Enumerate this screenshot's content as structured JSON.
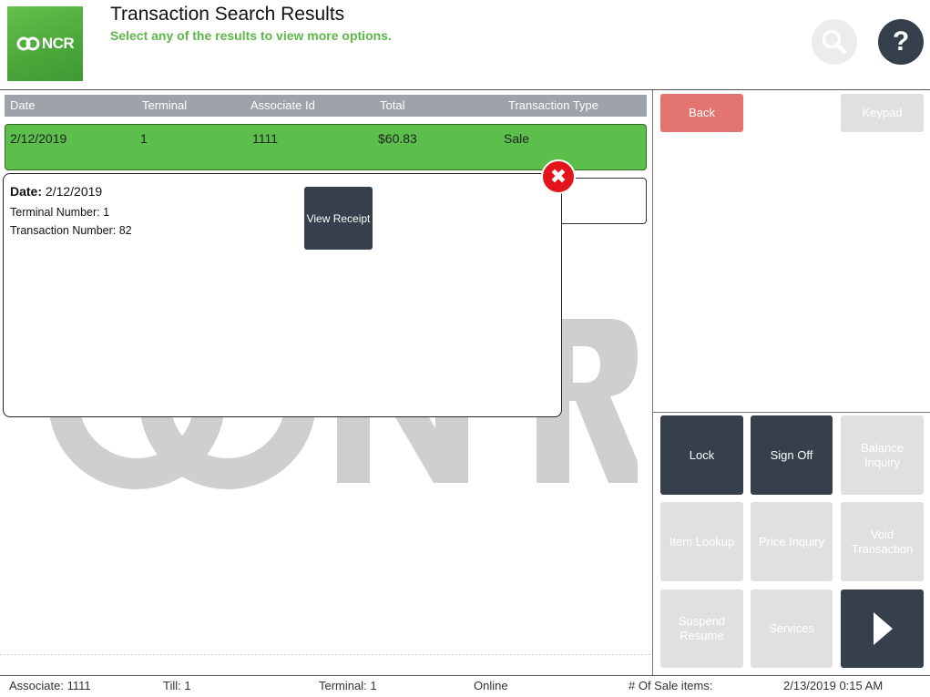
{
  "header": {
    "logo_text": "NCR",
    "title": "Transaction Search Results",
    "subtitle": "Select any of the results to view more options.",
    "help_label": "?"
  },
  "table": {
    "columns": [
      "Date",
      "Terminal",
      "Associate Id",
      "Total",
      "Transaction Type"
    ],
    "rows": [
      {
        "date": "2/12/2019",
        "terminal": "1",
        "associate_id": "1111",
        "total": "$60.83",
        "type": "Sale"
      }
    ]
  },
  "popup": {
    "date_label": "Date:",
    "date_value": "2/12/2019",
    "terminal_line": "Terminal Number: 1",
    "transaction_line": "Transaction Number: 82",
    "view_receipt_label": "View Receipt"
  },
  "right_panel": {
    "back_label": "Back",
    "keypad_label": "Keypad",
    "grid": {
      "lock": "Lock",
      "sign_off": "Sign Off",
      "balance_inquiry": "Balance Inquiry",
      "item_lookup": "Item Lookup",
      "price_inquiry": "Price Inquiry",
      "void_transaction": "Void Transaction",
      "suspend_resume": "Suspend Resume",
      "services": "Services"
    }
  },
  "status_bar": {
    "associate": "Associate: 1111",
    "till": "Till: 1",
    "terminal": "Terminal: 1",
    "connection": "Online",
    "sale_items": "# Of Sale items:",
    "datetime": "2/13/2019 0:15 AM"
  },
  "colors": {
    "brand_green": "#5cbe4b",
    "dark_button": "#35404c",
    "back_button": "#e47470",
    "close_red": "#e3151a",
    "disabled": "#e0e0e0"
  }
}
